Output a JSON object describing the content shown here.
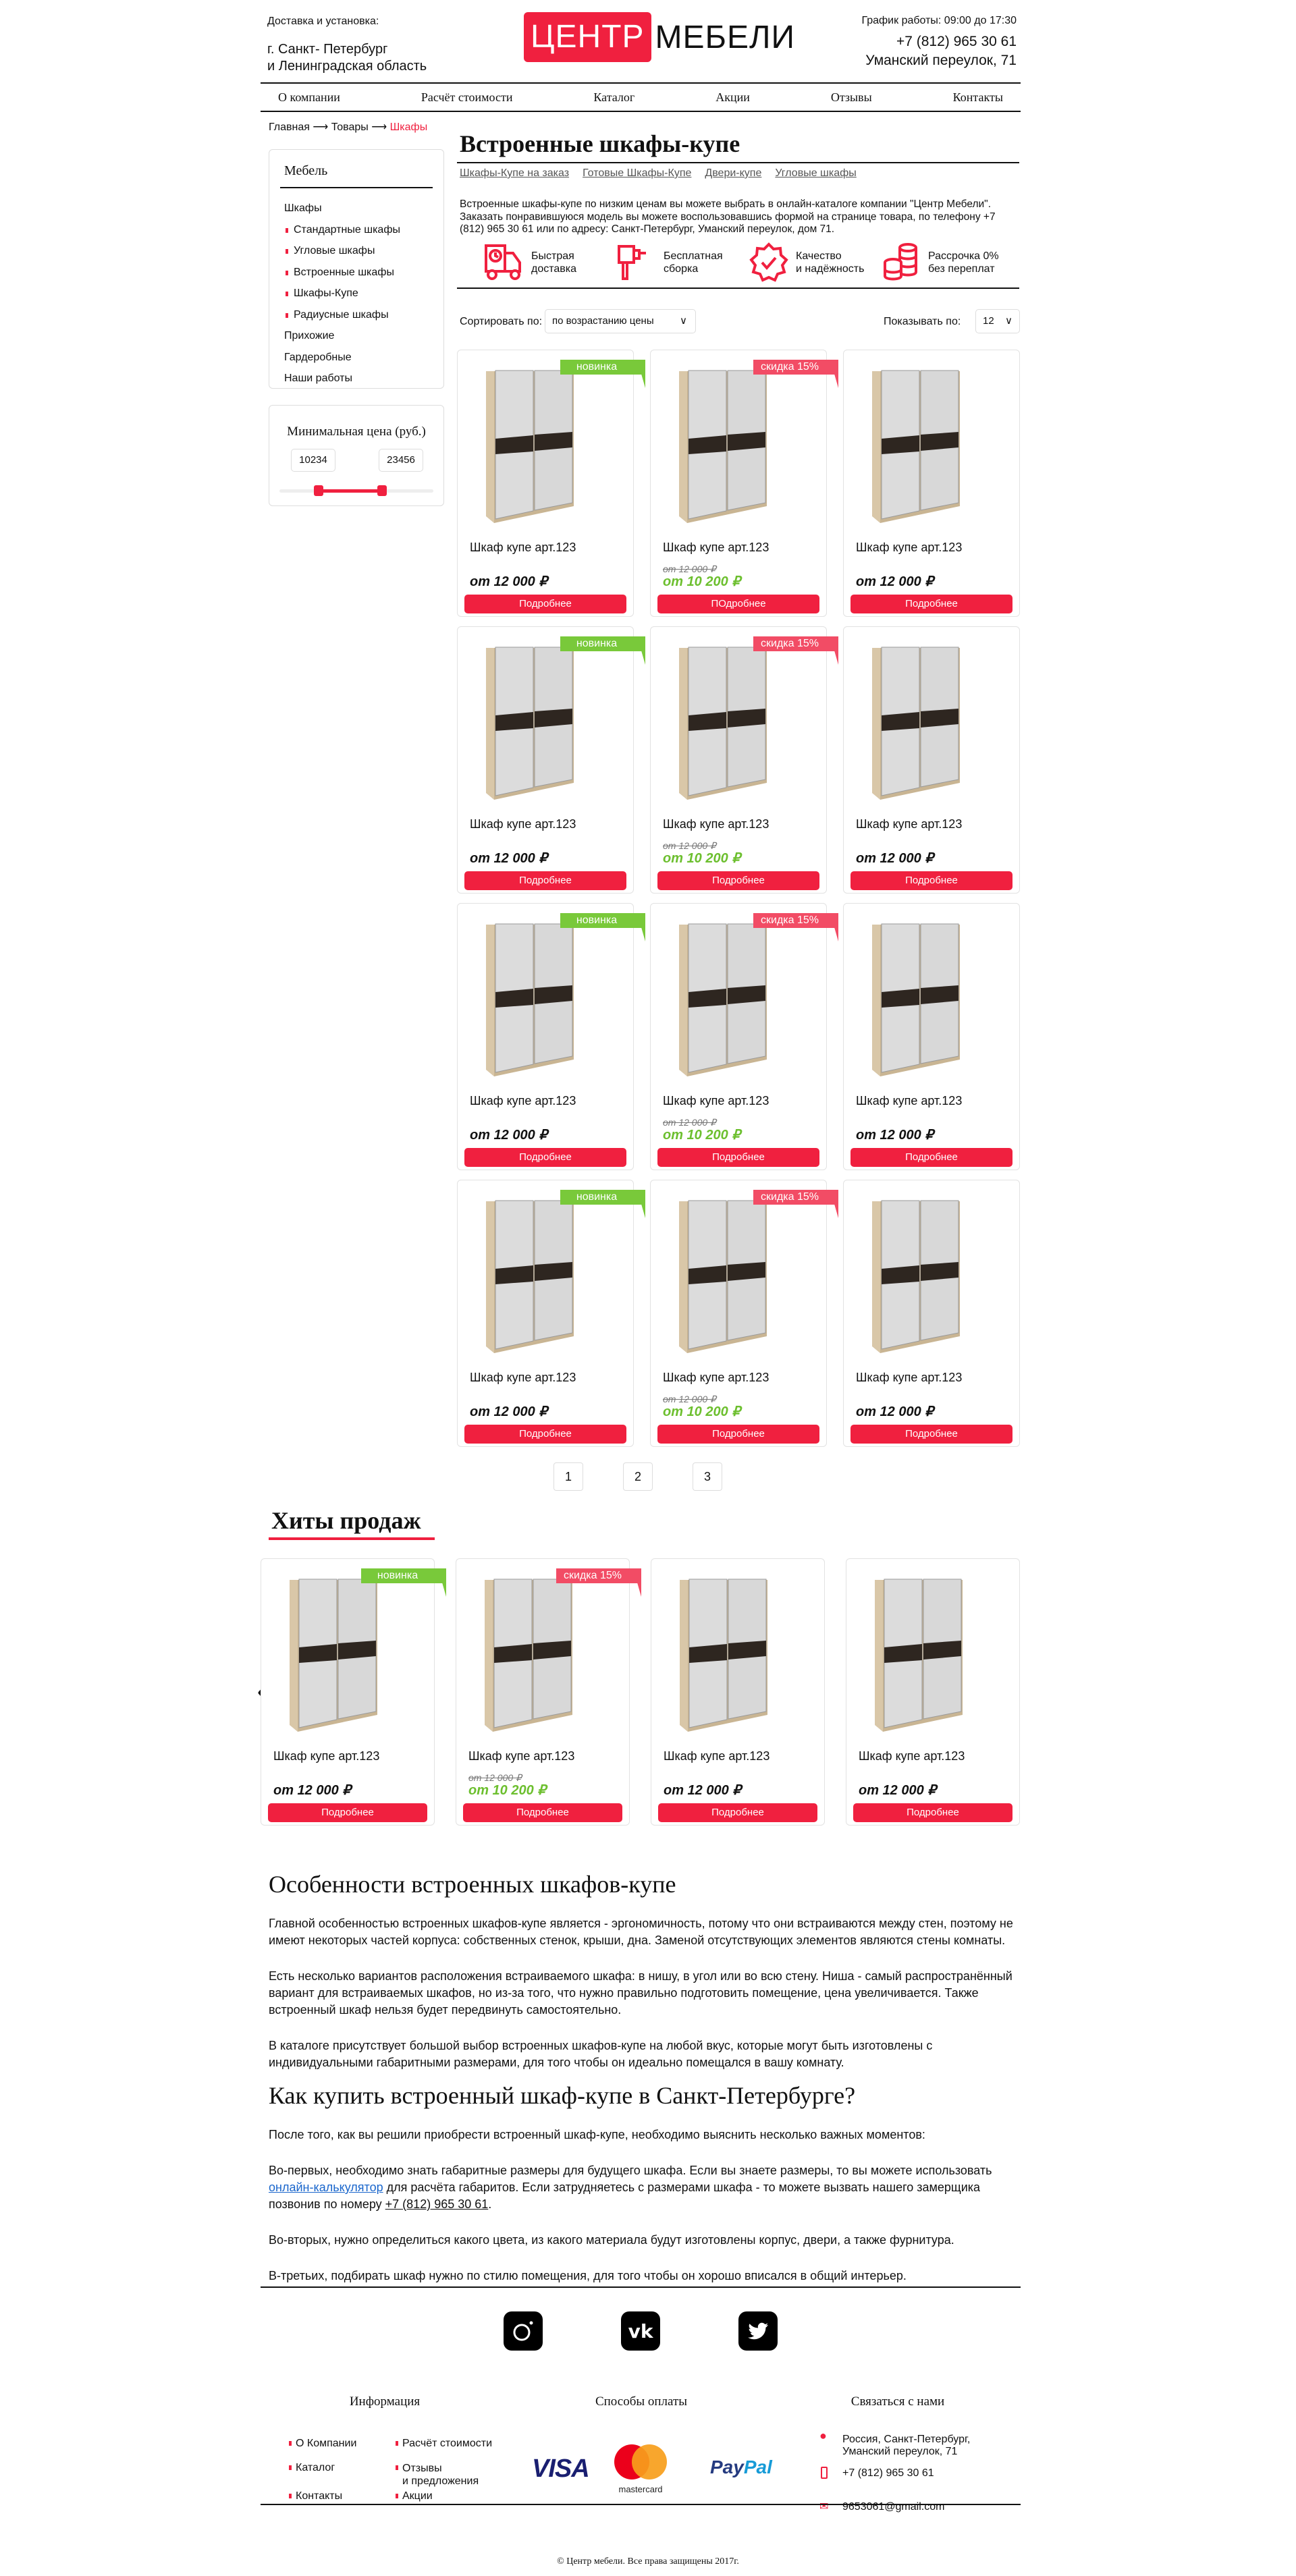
{
  "header": {
    "delivery_label": "Доставка и установка:",
    "city_line1": "г. Санкт- Петербург",
    "city_line2": "и Ленинградская область",
    "logo_red": "ЦЕНТР",
    "logo_black": "МЕБЕЛИ",
    "schedule": "График работы: 09:00 до 17:30",
    "phone": "+7 (812) 965 30 61",
    "address": "Уманский переулок, 71"
  },
  "nav": [
    "О компании",
    "Расчёт стоимости",
    "Каталог",
    "Акции",
    "Отзывы",
    "Контакты"
  ],
  "breadcrumb": {
    "items": [
      "Главная",
      "Товары"
    ],
    "separator": "⟶",
    "current": "Шкафы"
  },
  "sidebar": {
    "title": "Мебель",
    "items": [
      {
        "label": "Шкафы",
        "sub": false
      },
      {
        "label": "Стандартные шкафы",
        "sub": true
      },
      {
        "label": "Угловые шкафы",
        "sub": true
      },
      {
        "label": "Встроенные шкафы",
        "sub": true
      },
      {
        "label": "Шкафы-Купе",
        "sub": true
      },
      {
        "label": "Радиусные шкафы",
        "sub": true
      },
      {
        "label": "Прихожие",
        "sub": false
      },
      {
        "label": "Гардеробные",
        "sub": false
      },
      {
        "label": "Наши работы",
        "sub": false
      }
    ]
  },
  "price_filter": {
    "title": "Минимальная цена (руб.)",
    "min": "10234",
    "max": "23456",
    "range_start_pct": 25,
    "range_end_pct": 66
  },
  "page": {
    "title": "Встроенные шкафы-купе",
    "subnav": [
      "Шкафы-Купе на заказ",
      "Готовые Шкафы-Купе",
      "Двери-купе",
      "Угловые шкафы"
    ],
    "description": "Встроенные шкафы-купе по низким ценам вы можете выбрать в онлайн-каталоге компании \"Центр Мебели\". Заказать понравившуюся модель вы можете воспользовавшись формой на странице товара, по телефону +7 (812) 965 30 61 или по адресу: Санкт-Петербург, Уманский переулок, дом 71.",
    "features": [
      {
        "icon": "truck-clock-icon",
        "line1": "Быстрая",
        "line2": "доставка"
      },
      {
        "icon": "drill-icon",
        "line1": "Бесплатная",
        "line2": "сборка"
      },
      {
        "icon": "quality-badge-icon",
        "line1": "Качество",
        "line2": "и надёжность"
      },
      {
        "icon": "coins-icon",
        "line1": "Рассрочка 0%",
        "line2": "без переплат"
      }
    ],
    "sort_label": "Сортировать по:",
    "sort_value": "по возрастанию цены",
    "show_label": "Показывать по:",
    "show_value": "12"
  },
  "products": [
    {
      "name": "Шкаф купе арт.123",
      "badge": "новинка",
      "badge_type": "new",
      "old_price": null,
      "price": "от 12 000 ₽",
      "button": "Подробнее"
    },
    {
      "name": "Шкаф купе арт.123",
      "badge": "скидка 15%",
      "badge_type": "disc",
      "old_price": "от 12 000 ₽",
      "price": "от 10 200 ₽",
      "button": "ПОдробнее"
    },
    {
      "name": "Шкаф купе арт.123",
      "badge": null,
      "badge_type": null,
      "old_price": null,
      "price": "от 12 000 ₽",
      "button": "Подробнее"
    },
    {
      "name": "Шкаф купе арт.123",
      "badge": "новинка",
      "badge_type": "new",
      "old_price": null,
      "price": "от 12 000 ₽",
      "button": "Подробнее"
    },
    {
      "name": "Шкаф купе арт.123",
      "badge": "скидка 15%",
      "badge_type": "disc",
      "old_price": "от 12 000 ₽",
      "price": "от 10 200 ₽",
      "button": "Подробнее"
    },
    {
      "name": "Шкаф купе арт.123",
      "badge": null,
      "badge_type": null,
      "old_price": null,
      "price": "от 12 000 ₽",
      "button": "Подробнее"
    },
    {
      "name": "Шкаф купе арт.123",
      "badge": "новинка",
      "badge_type": "new",
      "old_price": null,
      "price": "от 12 000 ₽",
      "button": "Подробнее"
    },
    {
      "name": "Шкаф купе арт.123",
      "badge": "скидка 15%",
      "badge_type": "disc",
      "old_price": "от 12 000 ₽",
      "price": "от 10 200 ₽",
      "button": "Подробнее"
    },
    {
      "name": "Шкаф купе арт.123",
      "badge": null,
      "badge_type": null,
      "old_price": null,
      "price": "от 12 000 ₽",
      "button": "Подробнее"
    },
    {
      "name": "Шкаф купе арт.123",
      "badge": "новинка",
      "badge_type": "new",
      "old_price": null,
      "price": "от 12 000 ₽",
      "button": "Подробнее"
    },
    {
      "name": "Шкаф купе арт.123",
      "badge": "скидка 15%",
      "badge_type": "disc",
      "old_price": "от 12 000 ₽",
      "price": "от 10 200 ₽",
      "button": "Подробнее"
    },
    {
      "name": "Шкаф купе арт.123",
      "badge": null,
      "badge_type": null,
      "old_price": null,
      "price": "от 12 000 ₽",
      "button": "Подробнее"
    }
  ],
  "pagination": [
    "1",
    "2",
    "3"
  ],
  "hits": {
    "title": "Хиты продаж",
    "prev_icon": "chevron-left-icon",
    "next_icon": "chevron-right-icon",
    "items": [
      {
        "name": "Шкаф купе арт.123",
        "badge": "новинка",
        "badge_type": "new",
        "old_price": null,
        "price": "от 12 000 ₽",
        "button": "Подробнее"
      },
      {
        "name": "Шкаф купе арт.123",
        "badge": "скидка 15%",
        "badge_type": "disc",
        "old_price": "от 12 000 ₽",
        "price": "от 10 200 ₽",
        "button": "Подробнее"
      },
      {
        "name": "Шкаф купе арт.123",
        "badge": null,
        "badge_type": null,
        "old_price": null,
        "price": "от 12 000 ₽",
        "button": "Подробнее"
      },
      {
        "name": "Шкаф купе арт.123",
        "badge": null,
        "badge_type": null,
        "old_price": null,
        "price": "от 12 000 ₽",
        "button": "Подробнее"
      }
    ]
  },
  "article": {
    "h1": "Особенности встроенных шкафов-купе",
    "p1": "Главной особенностью встроенных шкафов-купе является - эргономичность, потому что они встраиваются между стен, поэтому не имеют некоторых частей корпуса: собственных стенок, крыши, дна. Заменой отсутствующих элементов являются стены комнаты.",
    "p2": "Есть несколько вариантов расположения встраиваемого шкафа: в нишу, в угол или во всю стену. Ниша - самый распространённый вариант для встраиваемых шкафов, но из-за того, что нужно правильно подготовить помещение, цена увеличивается. Также встроенный шкаф нельзя будет передвинуть самостоятельно.",
    "p3": "В каталоге присутствует большой выбор встроенных шкафов-купе на любой вкус, которые могут быть изготовлены с индивидуальными габаритными размерами, для того чтобы он идеально помещался в вашу комнату.",
    "h2": "Как купить встроенный шкаф-купе в Санкт-Петербурге?",
    "p4": "После того, как вы решили приобрести встроенный шкаф-купе, необходимо выяснить несколько важных моментов:",
    "p5_a": "Во-первых, необходимо знать габаритные размеры для будущего шкафа. Если вы знаете размеры, то вы можете использовать ",
    "p5_link": "онлайн-калькулятор",
    "p5_b": " для расчёта габаритов. Если затрудняетесь с размерами шкафа - то можете вызвать нашего замерщика позвонив по номеру ",
    "p5_phone": "+7 (812) 965 30 61",
    "p5_c": ".",
    "p6": "Во-вторых, нужно определиться какого цвета, из какого материала будут изготовлены корпус, двери, а также фурнитура.",
    "p7": "В-третьих, подбирать шкаф нужно по стилю помещения, для того чтобы он хорошо вписался в общий интерьер."
  },
  "footer": {
    "social": [
      "instagram-icon",
      "vk-icon",
      "twitter-icon"
    ],
    "info_title": "Информация",
    "info_links": [
      "О Компании",
      "Расчёт стоимости",
      "Контакты",
      "Акции",
      "Каталог",
      "Отзывы",
      "и предложения"
    ],
    "payment_title": "Способы оплаты",
    "payment": {
      "visa": "VISA",
      "mastercard": "mastercard",
      "paypal_a": "Pay",
      "paypal_b": "Pal"
    },
    "contact_title": "Связаться с нами",
    "address1": "Россия, Санкт-Петербург,",
    "address2": "Уманский переулок, 71",
    "phone": "+7 (812) 965 30 61",
    "email": "9653061@gmail.com",
    "copyright": "© Центр мебели. Все права защищены 2017г."
  },
  "colors": {
    "accent": "#f0203f",
    "new_badge": "#79c93a",
    "discount_badge": "#f24c65",
    "discount_price": "#6cbf2e"
  }
}
